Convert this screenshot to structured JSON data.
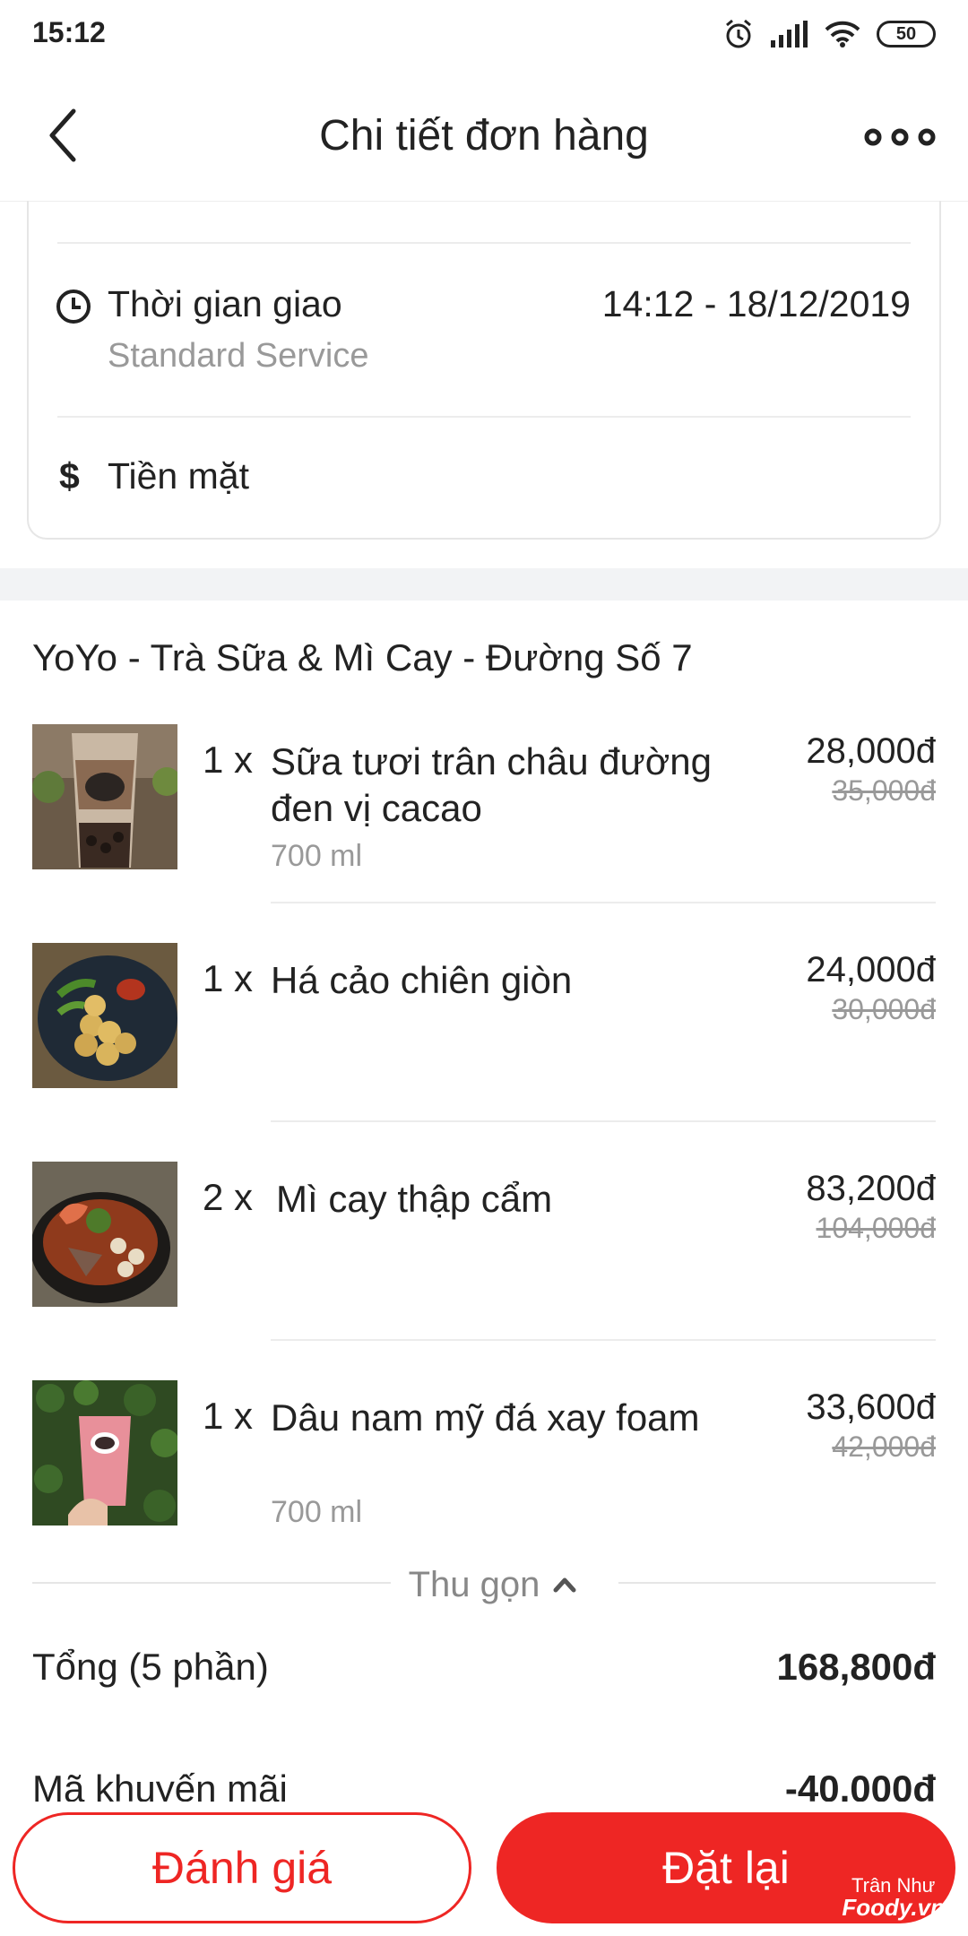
{
  "status_bar": {
    "time": "15:12",
    "battery": "50"
  },
  "header": {
    "title": "Chi tiết đơn hàng"
  },
  "delivery": {
    "time_label": "Thời gian giao",
    "service": "Standard Service",
    "time_value": "14:12 - 18/12/2019",
    "payment": "Tiền mặt"
  },
  "restaurant": {
    "name": "YoYo - Trà Sữa & Mì Cay - Đường Số 7"
  },
  "items": [
    {
      "qty": "1 x",
      "name": "Sữa tươi trân châu đường đen vị cacao",
      "option": "700 ml",
      "price": "28,000đ",
      "old_price": "35,000đ"
    },
    {
      "qty": "1 x",
      "name": "Há cảo chiên giòn",
      "option": "",
      "price": "24,000đ",
      "old_price": "30,000đ"
    },
    {
      "qty": "2 x",
      "name": "Mì cay thập cẩm",
      "option": "",
      "price": "83,200đ",
      "old_price": "104,000đ"
    },
    {
      "qty": "1 x",
      "name": "Dâu nam mỹ đá xay foam",
      "option": "700 ml",
      "price": "33,600đ",
      "old_price": "42,000đ"
    }
  ],
  "collapse": {
    "label": "Thu gọn"
  },
  "summary": {
    "total_label": "Tổng (5 phần)",
    "total_value": "168,800đ",
    "promo_label": "Mã khuyến mãi",
    "promo_value": "-40,000đ"
  },
  "actions": {
    "rate": "Đánh giá",
    "reorder": "Đặt lại"
  },
  "watermark": {
    "line1": "Trân Như",
    "line2": "Foody.vn"
  },
  "colors": {
    "accent": "#ee2624",
    "muted": "#999999"
  }
}
